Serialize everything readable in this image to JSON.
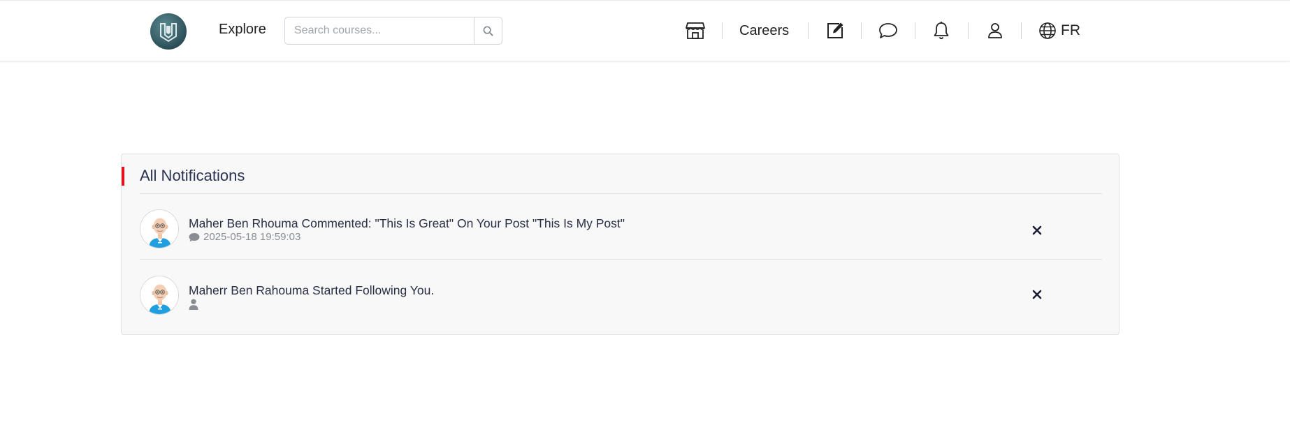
{
  "header": {
    "logo_icon": "brand-logo-icon",
    "explore_label": "Explore",
    "search": {
      "placeholder": "Search courses...",
      "value": "",
      "button_icon": "search-icon"
    },
    "nav": {
      "store_icon": "store-icon",
      "careers_label": "Careers",
      "edit_icon": "edit-icon",
      "messages_icon": "chat-icon",
      "notifications_icon": "bell-icon",
      "profile_icon": "user-icon",
      "language_icon": "globe-icon",
      "language_label": "FR"
    }
  },
  "notifications": {
    "title": "All Notifications",
    "accent_color": "#e3121b",
    "items": [
      {
        "text": "Maher Ben Rhouma Commented: \"This Is Great\" On Your Post \"This Is My Post\"",
        "type_icon": "comment-icon",
        "timestamp": "2025-05-18 19:59:03"
      },
      {
        "text": "Maherr Ben Rahouma Started Following You.",
        "type_icon": "user-icon",
        "timestamp": ""
      }
    ]
  }
}
